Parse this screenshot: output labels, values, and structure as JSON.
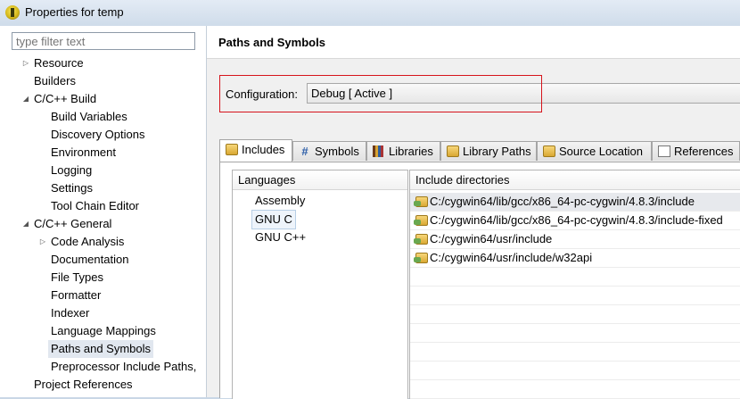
{
  "window": {
    "title": "Properties for temp"
  },
  "filter": {
    "placeholder": "type filter text"
  },
  "tree": [
    {
      "label": "Resource",
      "twisty": "▷"
    },
    {
      "label": "Builders",
      "twisty": ""
    },
    {
      "label": "C/C++ Build",
      "twisty": "◢"
    },
    {
      "label": "Build Variables",
      "twisty": ""
    },
    {
      "label": "Discovery Options",
      "twisty": ""
    },
    {
      "label": "Environment",
      "twisty": ""
    },
    {
      "label": "Logging",
      "twisty": ""
    },
    {
      "label": "Settings",
      "twisty": ""
    },
    {
      "label": "Tool Chain Editor",
      "twisty": ""
    },
    {
      "label": "C/C++ General",
      "twisty": "◢"
    },
    {
      "label": "Code Analysis",
      "twisty": "▷"
    },
    {
      "label": "Documentation",
      "twisty": ""
    },
    {
      "label": "File Types",
      "twisty": ""
    },
    {
      "label": "Formatter",
      "twisty": ""
    },
    {
      "label": "Indexer",
      "twisty": ""
    },
    {
      "label": "Language Mappings",
      "twisty": ""
    },
    {
      "label": "Paths and Symbols",
      "twisty": "",
      "selected": true
    },
    {
      "label": "Preprocessor Include Paths,",
      "twisty": ""
    },
    {
      "label": "Project References",
      "twisty": ""
    }
  ],
  "page": {
    "title": "Paths and Symbols",
    "configuration_label": "Configuration:",
    "configuration_value": "Debug  [ Active ]"
  },
  "tabs": [
    {
      "label": "Includes",
      "icon": "folder-icon",
      "active": true
    },
    {
      "label": "Symbols",
      "icon": "hash-icon"
    },
    {
      "label": "Libraries",
      "icon": "library-icon"
    },
    {
      "label": "Library Paths",
      "icon": "folder-icon"
    },
    {
      "label": "Source Location",
      "icon": "folder-icon"
    },
    {
      "label": "References",
      "icon": "document-icon"
    }
  ],
  "languages": {
    "header": "Languages",
    "items": [
      {
        "label": "Assembly"
      },
      {
        "label": "GNU C",
        "selected": true
      },
      {
        "label": "GNU C++"
      }
    ]
  },
  "includes": {
    "header": "Include directories",
    "items": [
      {
        "path": "C:/cygwin64/lib/gcc/x86_64-pc-cygwin/4.8.3/include"
      },
      {
        "path": "C:/cygwin64/lib/gcc/x86_64-pc-cygwin/4.8.3/include-fixed"
      },
      {
        "path": "C:/cygwin64/usr/include"
      },
      {
        "path": "C:/cygwin64/usr/include/w32api"
      }
    ]
  },
  "colors": {
    "highlight_box": "#d6141c",
    "selection": "#e1e7ef"
  }
}
